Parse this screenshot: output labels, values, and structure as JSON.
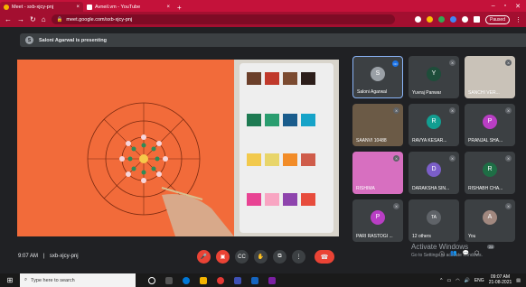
{
  "browser": {
    "tabs": [
      {
        "label": "Meet - sxb-xjcy-pnj",
        "active": true
      },
      {
        "label": "Avneil.vm - YouTube",
        "active": false
      }
    ],
    "url": "meet.google.com/sxb-xjcy-pnj",
    "paused_label": "Paused"
  },
  "meet": {
    "presenter_initial": "S",
    "presenting_text": "Saloni Agarwal is presenting",
    "participants": [
      {
        "name": "Saloni Agarwal",
        "initial": "S",
        "color": "#9aa0a6"
      },
      {
        "name": "Yuvraj Panwar",
        "initial": "Y",
        "color": "#1e4d3a"
      },
      {
        "name": "SANCHI VER...",
        "initial": "",
        "color": "#c9c2b8"
      },
      {
        "name": "SAANVI 10488",
        "initial": "",
        "color": "#6b5a46"
      },
      {
        "name": "RAVYA KESAR...",
        "initial": "R",
        "color": "#129e91"
      },
      {
        "name": "PRANJAL SHA...",
        "initial": "P",
        "color": "#b93ec4"
      },
      {
        "name": "RISHIMA",
        "initial": "",
        "color": "#d76fc0"
      },
      {
        "name": "DARAKSHA SIN...",
        "initial": "D",
        "color": "#7b5ec8"
      },
      {
        "name": "RISHABH CHA...",
        "initial": "R",
        "color": "#1e6e45"
      },
      {
        "name": "PARI RASTOGI ...",
        "initial": "P",
        "color": "#b93ec4"
      },
      {
        "name": "12 others",
        "initial": "TA",
        "color": "#5f6368"
      },
      {
        "name": "You",
        "initial": "A",
        "color": "#a1887f"
      }
    ],
    "time": "9:07 AM",
    "separator": "|",
    "meeting_code": "sxb-xjcy-pnj",
    "badge_count": "24"
  },
  "windows": {
    "activate_title": "Activate Windows",
    "activate_sub": "Go to Settings to activate Windows.",
    "search_placeholder": "Type here to search",
    "lang": "ENG",
    "clock_time": "09:07 AM",
    "clock_date": "21-08-2021"
  }
}
